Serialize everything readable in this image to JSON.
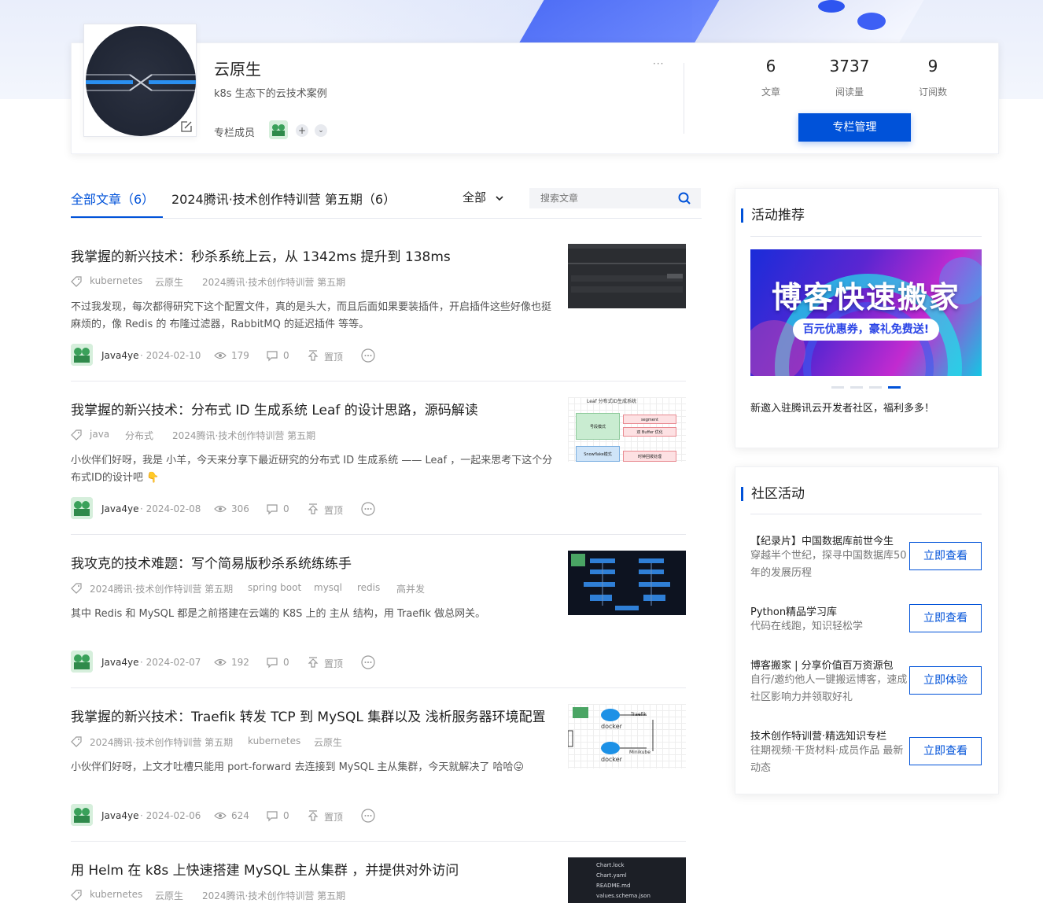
{
  "column": {
    "name": "云原生",
    "description": "k8s 生态下的云技术案例",
    "member_label": "专栏成员",
    "more": "···",
    "stats": [
      {
        "value": "6",
        "label": "文章"
      },
      {
        "value": "3737",
        "label": "阅读量"
      },
      {
        "value": "9",
        "label": "订阅数"
      }
    ],
    "manage_label": "专栏管理"
  },
  "tabs": [
    {
      "label": "全部文章（6）",
      "active": true
    },
    {
      "label": "2024腾讯·技术创作特训营 第五期（6）",
      "active": false
    }
  ],
  "filter": {
    "label": "全部"
  },
  "search": {
    "placeholder": "搜索文章"
  },
  "articles": [
    {
      "title": "我掌握的新兴技术：秒杀系统上云，从 1342ms 提升到 138ms",
      "tags": [
        "kubernetes",
        "云原生",
        "2024腾讯·技术创作特训营 第五期"
      ],
      "desc": "不过我发现，每次都得研究下这个配置文件，真的是头大，而且后面如果要装插件，开启插件这些好像也挺麻烦的，像 Redis 的 布隆过滤器，RabbitMQ 的延迟插件 等等。",
      "author": "Java4ye",
      "date": "· 2024-02-10",
      "views": "179",
      "comments": "0",
      "pin": "置顶"
    },
    {
      "title": "我掌握的新兴技术：分布式 ID 生成系统 Leaf 的设计思路，源码解读",
      "tags": [
        "java",
        "分布式",
        "2024腾讯·技术创作特训营 第五期"
      ],
      "desc": "小伙伴们好呀，我是 小羊，今天来分享下最近研究的分布式 ID 生成系统 —— Leaf ，一起来思考下这个分布式ID的设计吧 👇",
      "author": "Java4ye",
      "date": "· 2024-02-08",
      "views": "306",
      "comments": "0",
      "pin": "置顶"
    },
    {
      "title": "我攻克的技术难题：写个简易版秒杀系统练练手",
      "tags": [
        "2024腾讯·技术创作特训营 第五期",
        "spring boot",
        "mysql",
        "redis",
        "高并发"
      ],
      "desc": "其中 Redis 和 MySQL 都是之前搭建在云端的 K8S 上的 主从 结构，用 Traefik 做总网关。",
      "author": "Java4ye",
      "date": "· 2024-02-07",
      "views": "192",
      "comments": "0",
      "pin": "置顶"
    },
    {
      "title": "我掌握的新兴技术：Traefik 转发 TCP 到 MySQL 集群以及 浅析服务器环境配置",
      "tags": [
        "2024腾讯·技术创作特训营 第五期",
        "kubernetes",
        "云原生"
      ],
      "desc": "小伙伴们好呀，上文才吐槽只能用 port-forward 去连接到 MySQL 主从集群，今天就解决了 哈哈😛",
      "author": "Java4ye",
      "date": "· 2024-02-06",
      "views": "624",
      "comments": "0",
      "pin": "置顶"
    },
    {
      "title": "用 Helm 在 k8s 上快速搭建 MySQL 主从集群 ，并提供对外访问",
      "tags": [
        "kubernetes",
        "云原生",
        "2024腾讯·技术创作特训营 第五期"
      ],
      "desc": "",
      "author": "",
      "date": "",
      "views": "",
      "comments": "",
      "pin": ""
    }
  ],
  "thumbs": {
    "leaf_title": "Leaf 分布式ID生成系统",
    "leaf_box1": "号段模式",
    "leaf_box2": "segment",
    "leaf_box3": "双 Buffer 优化",
    "leaf_box4": "Snowflake模式",
    "leaf_box5": "时钟回拨处理",
    "docker1": "docker",
    "docker2": "docker",
    "traefik": "Traefik",
    "minikube": "Minikube",
    "helm_files": [
      "Chart.lock",
      "Chart.yaml",
      "README.md",
      "values.schema.json"
    ]
  },
  "sidebar": {
    "recommend_title": "活动推荐",
    "promo_title": "博客快速搬家",
    "promo_sub": "百元优惠券，豪礼免费送!",
    "promo_caption": "新邀入驻腾讯云开发者社区，福利多多！",
    "community_title": "社区活动",
    "activities": [
      {
        "title": "【纪录片】中国数据库前世今生",
        "desc": "穿越半个世纪，探寻中国数据库50年的发展历程",
        "button": "立即查看"
      },
      {
        "title": "Python精品学习库",
        "desc": "代码在线跑，知识轻松学",
        "button": "立即查看"
      },
      {
        "title": "博客搬家 | 分享价值百万资源包",
        "desc": "自行/邀约他人一键搬运博客，速成社区影响力并领取好礼",
        "button": "立即体验"
      },
      {
        "title": "技术创作特训营·精选知识专栏",
        "desc": "往期视频·干货材料·成员作品 最新动态",
        "button": "立即查看"
      }
    ]
  },
  "colors": {
    "accent": "#0052d9"
  }
}
